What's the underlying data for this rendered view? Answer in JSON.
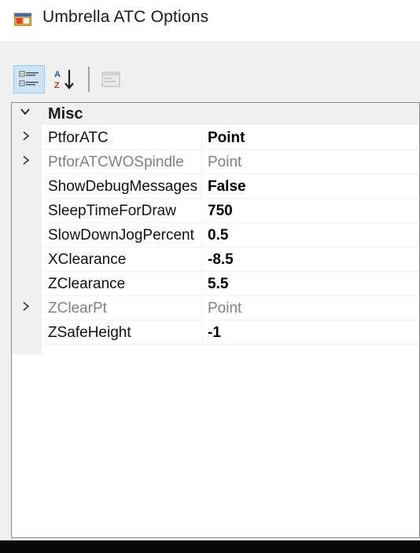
{
  "window": {
    "title": "Umbrella ATC Options",
    "icon": "app-window-icon"
  },
  "toolbar": {
    "categorized_icon": "categorized-view-icon",
    "alphabetical_icon": "alphabetical-sort-icon",
    "property_pages_icon": "property-pages-icon"
  },
  "category": {
    "label": "Misc",
    "expanded": true
  },
  "properties": [
    {
      "name": "PtforATC",
      "value": "Point",
      "expandable": true,
      "bold": true,
      "dim": false
    },
    {
      "name": "PtforATCWOSpindle",
      "value": "Point",
      "expandable": true,
      "bold": false,
      "dim": true
    },
    {
      "name": "ShowDebugMessages",
      "value": "False",
      "expandable": false,
      "bold": true,
      "dim": false
    },
    {
      "name": "SleepTimeForDraw",
      "value": "750",
      "expandable": false,
      "bold": true,
      "dim": false
    },
    {
      "name": "SlowDownJogPercent",
      "value": "0.5",
      "expandable": false,
      "bold": true,
      "dim": false
    },
    {
      "name": "XClearance",
      "value": "-8.5",
      "expandable": false,
      "bold": true,
      "dim": false
    },
    {
      "name": "ZClearance",
      "value": "5.5",
      "expandable": false,
      "bold": true,
      "dim": false
    },
    {
      "name": "ZClearPt",
      "value": "Point",
      "expandable": true,
      "bold": false,
      "dim": true
    },
    {
      "name": "ZSafeHeight",
      "value": "-1",
      "expandable": false,
      "bold": true,
      "dim": false
    }
  ],
  "colors": {
    "selected_button": "#cce4f7",
    "gutter": "#f0f0f0",
    "dim_text": "#808080"
  }
}
